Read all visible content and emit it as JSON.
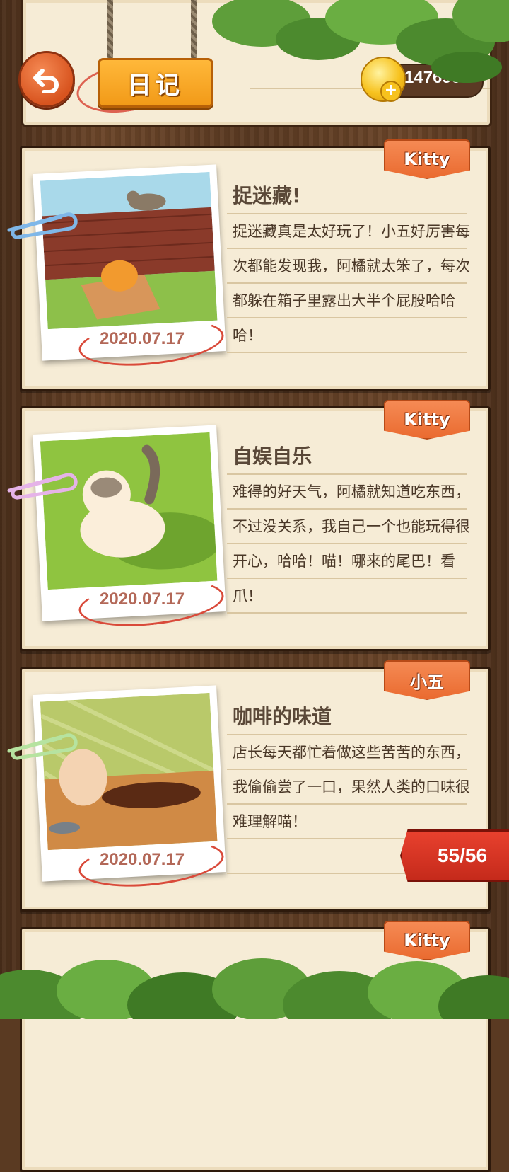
{
  "header": {
    "title": "日记",
    "coins": "147695"
  },
  "entries": [
    {
      "tag": "Kitty",
      "title": "捉迷藏!",
      "body": "捉迷藏真是太好玩了！小五好厉害每次都能发现我，阿橘就太笨了，每次都躲在箱子里露出大半个屁股哈哈哈！",
      "date": "2020.07.17"
    },
    {
      "tag": "Kitty",
      "title": "自娱自乐",
      "body": "难得的好天气，阿橘就知道吃东西，不过没关系，我自己一个也能玩得很开心，哈哈！喵！哪来的尾巴！看爪！",
      "date": "2020.07.17"
    },
    {
      "tag": "小五",
      "title": "咖啡的味道",
      "body": "店长每天都忙着做这些苦苦的东西，我偷偷尝了一口，果然人类的口味很难理解喵！",
      "date": "2020.07.17"
    },
    {
      "tag": "Kitty"
    }
  ],
  "page_indicator": "55/56",
  "icons": [
    "back-arrow-icon",
    "coin-icon",
    "plus-icon",
    "paperclip-icon"
  ],
  "colors": {
    "accent": "#ea6b30",
    "paper": "#f6ecd6",
    "badge": "#c52a1b"
  }
}
